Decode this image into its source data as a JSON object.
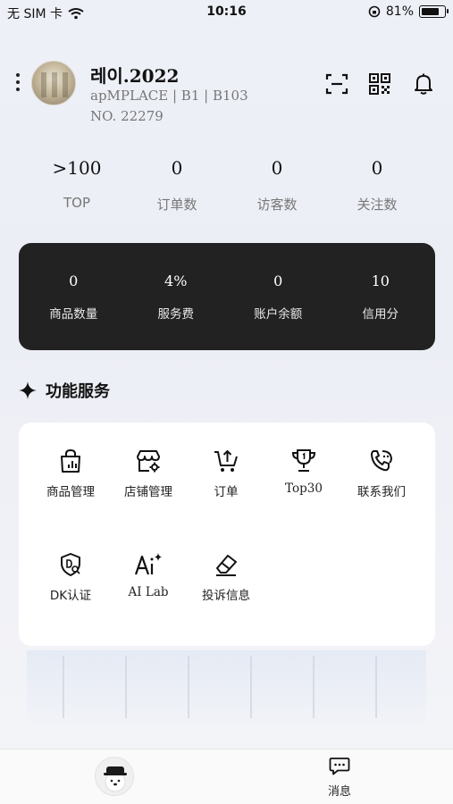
{
  "status_bar": {
    "carrier": "无 SIM 卡",
    "time": "10:16",
    "battery": "81%",
    "battery_level": 0.81
  },
  "profile": {
    "name": "레이.2022",
    "location": "apMPLACE | B1 | B103",
    "number": "NO. 22279"
  },
  "stats": [
    {
      "value": ">100",
      "label": "TOP"
    },
    {
      "value": "0",
      "label": "订单数"
    },
    {
      "value": "0",
      "label": "访客数"
    },
    {
      "value": "0",
      "label": "关注数"
    }
  ],
  "summary": [
    {
      "value": "0",
      "label": "商品数量"
    },
    {
      "value": "4%",
      "label": "服务费"
    },
    {
      "value": "0",
      "label": "账户余额"
    },
    {
      "value": "10",
      "label": "信用分"
    }
  ],
  "section": {
    "title": "功能服务"
  },
  "functions": [
    {
      "label": "商品管理",
      "icon": "shopping-bag-chart-icon"
    },
    {
      "label": "店铺管理",
      "icon": "store-settings-icon"
    },
    {
      "label": "订单",
      "icon": "cart-upload-icon"
    },
    {
      "label": "Top30",
      "icon": "trophy-icon"
    },
    {
      "label": "联系我们",
      "icon": "phone-chat-icon"
    },
    {
      "label": "DK认证",
      "icon": "shield-search-icon"
    },
    {
      "label": "AI Lab",
      "icon": "ai-sparkle-icon"
    },
    {
      "label": "投诉信息",
      "icon": "eraser-icon"
    }
  ],
  "tabbar": {
    "message_label": "消息"
  }
}
